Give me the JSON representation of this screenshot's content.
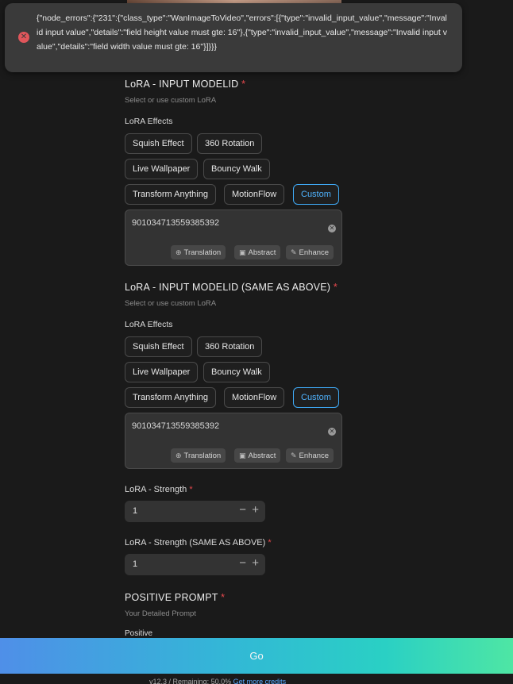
{
  "error": {
    "message": "{\"node_errors\":{\"231\":{\"class_type\":\"WanImageToVideo\",\"errors\":[{\"type\":\"invalid_input_value\",\"message\":\"Invalid input value\",\"details\":\"field height value must gte: 16\"},{\"type\":\"invalid_input_value\",\"message\":\"Invalid input value\",\"details\":\"field width value must gte: 16\"}]}}}"
  },
  "lora1": {
    "title": "LoRA - INPUT MODELID",
    "required": "*",
    "hint": "Select or use custom LoRA",
    "effects_label": "LoRA Effects",
    "chips": [
      "Squish Effect",
      "360 Rotation",
      "Live Wallpaper",
      "Bouncy Walk",
      "Transform Anything",
      "MotionFlow",
      "Custom"
    ],
    "model_id": "901034713559385392",
    "tools": [
      "Translation",
      "Abstract",
      "Enhance"
    ]
  },
  "lora2": {
    "title": "LoRA - INPUT MODELID (SAME AS ABOVE)",
    "required": "*",
    "hint": "Select or use custom LoRA",
    "effects_label": "LoRA Effects",
    "chips": [
      "Squish Effect",
      "360 Rotation",
      "Live Wallpaper",
      "Bouncy Walk",
      "Transform Anything",
      "MotionFlow",
      "Custom"
    ],
    "model_id": "901034713559385392",
    "tools": [
      "Translation",
      "Abstract",
      "Enhance"
    ]
  },
  "strength1": {
    "label": "LoRA - Strength",
    "required": "*",
    "value": "1"
  },
  "strength2": {
    "label": "LoRA - Strength (SAME AS ABOVE)",
    "required": "*",
    "value": "1"
  },
  "prompt": {
    "title": "POSITIVE PROMPT",
    "required": "*",
    "hint": "Your Detailed Prompt",
    "field_label": "Positive"
  },
  "go_label": "Go",
  "footer": {
    "version": "v12.3",
    "remaining": "/ Remaining: 50.0%",
    "link": "Get more credits"
  },
  "colors": {
    "accent": "#3fa9f5",
    "required": "#e5484d",
    "error": "#e0565b"
  }
}
